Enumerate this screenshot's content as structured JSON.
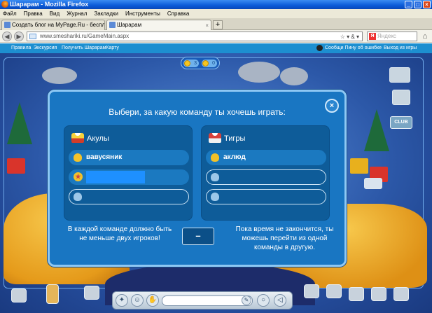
{
  "window": {
    "title": "Шарарам - Mozilla Firefox"
  },
  "menu": [
    "Файл",
    "Правка",
    "Вид",
    "Журнал",
    "Закладки",
    "Инструменты",
    "Справка"
  ],
  "tabs": [
    {
      "label": "Создать блог на MyPage.Ru - бесплат...",
      "active": false
    },
    {
      "label": "Шарарам",
      "active": true
    }
  ],
  "address": {
    "url": "www.smeshariki.ru/GameMain.aspx"
  },
  "search": {
    "placeholder": "Яндекс",
    "brand": "Я"
  },
  "site_links": {
    "left": [
      "Правила",
      "Экскурсия",
      "Получить ШарарамКарту"
    ],
    "right": [
      "Сообщи Пину об ошибке",
      "Выход из игры"
    ]
  },
  "hud": {
    "coins": "3",
    "other": "0"
  },
  "club_label": "CLUB",
  "modal": {
    "title": "Выбери, за какую команду ты хочешь играть:",
    "close_label": "×",
    "teams": [
      {
        "name": "Акулы",
        "players": [
          "вавусяник",
          "",
          ""
        ]
      },
      {
        "name": "Тигры",
        "players": [
          "аклюд",
          "",
          ""
        ]
      }
    ],
    "info_left": "В каждой команде должно быть не меньше двух игроков!",
    "timer": "–",
    "info_right": "Пока время не закончится, ты можешь перейти из одной команды в другую."
  },
  "colors": {
    "modal_bg": "#1976c2",
    "team_panel": "#0e5c99",
    "accent": "#8ec8f4",
    "highlight_field": "#1e90ff"
  }
}
